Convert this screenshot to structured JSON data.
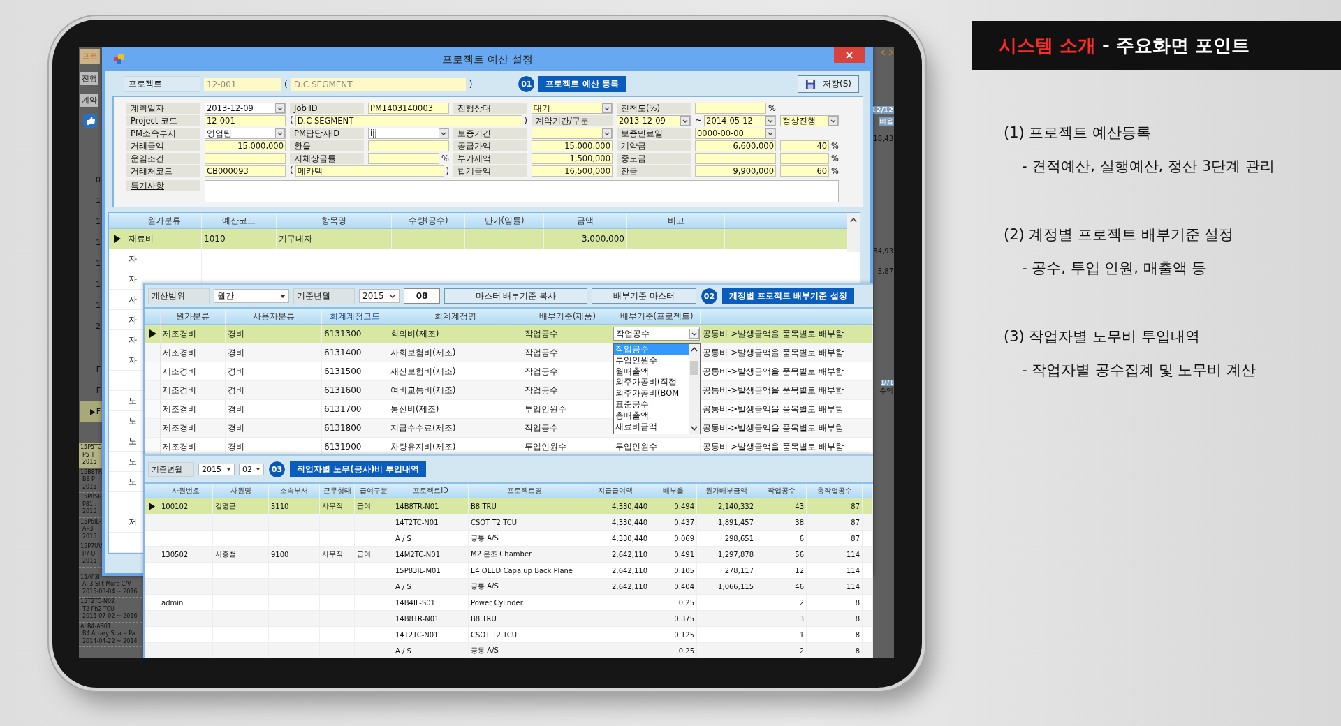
{
  "slide": {
    "title_highlight": "시스템 소개",
    "title_rest": " - 주요화면 포인트",
    "points": [
      {
        "heading": "(1) 프로젝트 예산등록",
        "detail": "- 견적예산, 실행예산, 정산 3단계 관리"
      },
      {
        "heading": "(2) 계정별 프로젝트 배부기준 설정",
        "detail": "- 공수, 투입 인원, 매출액 등"
      },
      {
        "heading": "(3) 작업자별 노무비 투입내역",
        "detail": "- 작업자별 공수집계 및 노무비 계산"
      }
    ]
  },
  "background_app": {
    "tab": "프로",
    "labels": [
      "진행",
      "계약"
    ],
    "row_marks": [
      {
        "text": "0",
        "selected": false
      },
      {
        "text": "1",
        "selected": false
      },
      {
        "text": "1",
        "selected": false
      },
      {
        "text": "1",
        "selected": false
      },
      {
        "text": "1",
        "selected": false
      },
      {
        "text": "1",
        "selected": false
      },
      {
        "text": "1",
        "selected": false
      },
      {
        "text": "2",
        "selected": false
      },
      {
        "text": "F",
        "selected": false
      },
      {
        "text": "F",
        "selected": false
      },
      {
        "text": "F",
        "selected": true
      }
    ],
    "projects": [
      {
        "code": "15P5TC",
        "name": "P5 T",
        "period": "2015",
        "selected": true
      },
      {
        "code": "15B8TR",
        "name": "B8 P",
        "period": "2015",
        "selected": false
      },
      {
        "code": "15P8SI-",
        "name": "P81 :",
        "period": "2015",
        "selected": false
      },
      {
        "code": "15P6IL-",
        "name": "AP3",
        "period": "2015",
        "selected": false
      },
      {
        "code": "15P7UV",
        "name": "P7 U",
        "period": "2015",
        "selected": false
      },
      {
        "code": "15AP3I",
        "name": "AP3 Slit Mura C/V",
        "period": "2015-08-04 ~ 2016",
        "selected": false
      },
      {
        "code": "15T2TC-N02",
        "name": "T2 Ph2 TCU",
        "period": "2015-07-02 ~ 2016",
        "selected": false
      },
      {
        "code": "ALB4-AS01",
        "name": "B4 Arrary Spare Pa",
        "period": "2014-04-22 ~ 2014",
        "selected": false
      }
    ],
    "right_values": [
      "12/12",
      "비율",
      "18,43",
      "34,93",
      "5,87",
      "1/71",
      "수익"
    ]
  },
  "dialog": {
    "title": "프로젝트 예산 설정",
    "project": {
      "label": "프로젝트",
      "code": "12-001",
      "open": "(",
      "name": "D.C SEGMENT",
      "close": ")"
    },
    "step": {
      "number": "01",
      "title": "프로젝트 예산 등록"
    },
    "save_button": "저장(S)",
    "form": {
      "lines": [
        {
          "items": [
            {
              "kind": "label",
              "text": "계획일자"
            },
            {
              "kind": "picker",
              "value": "2013-12-09"
            },
            {
              "kind": "label",
              "text": "Job ID"
            },
            {
              "kind": "input",
              "value": "PM1403140003"
            },
            {
              "kind": "label",
              "text": "진행상태"
            },
            {
              "kind": "combo",
              "value": "대기"
            },
            {
              "kind": "label",
              "text": "진척도(%)"
            },
            {
              "kind": "input",
              "suffix": "%"
            }
          ]
        },
        {
          "items": [
            {
              "kind": "label",
              "text": "Project 코드"
            },
            {
              "kind": "input",
              "value": "12-001"
            },
            {
              "kind": "input",
              "value": "D.C SEGMENT",
              "prefix": "(",
              "suffix": ")"
            },
            {
              "kind": "label",
              "text": "계약기간/구분"
            },
            {
              "kind": "combo",
              "value": "2013-12-09"
            },
            {
              "kind": "combo",
              "value": "2014-05-12",
              "prefix": "~"
            },
            {
              "kind": "combo",
              "value": "정상진행"
            }
          ]
        },
        {
          "items": [
            {
              "kind": "label",
              "text": "PM소속부서"
            },
            {
              "kind": "picker",
              "value": "영업팀"
            },
            {
              "kind": "label",
              "text": "PM담당자ID"
            },
            {
              "kind": "picker",
              "value": "ijj"
            },
            {
              "kind": "label",
              "text": "보증기간"
            },
            {
              "kind": "combo"
            },
            {
              "kind": "label",
              "text": "보증만료일"
            },
            {
              "kind": "combo",
              "value": "0000-00-00"
            }
          ]
        },
        {
          "items": [
            {
              "kind": "label",
              "text": "거래금액"
            },
            {
              "kind": "input",
              "value": "15,000,000",
              "numeric": true
            },
            {
              "kind": "label",
              "text": "환율"
            },
            {
              "kind": "input"
            },
            {
              "kind": "label",
              "text": "공급가액"
            },
            {
              "kind": "input",
              "value": "15,000,000",
              "numeric": true
            },
            {
              "kind": "label",
              "text": "계약금"
            },
            {
              "kind": "input",
              "value": "6,600,000",
              "numeric": true
            },
            {
              "kind": "input",
              "value": "40",
              "numeric": true,
              "suffix": "%"
            }
          ]
        },
        {
          "items": [
            {
              "kind": "label",
              "text": "운임조건"
            },
            {
              "kind": "input"
            },
            {
              "kind": "label",
              "text": "지체상금률"
            },
            {
              "kind": "input",
              "suffix": "%"
            },
            {
              "kind": "label",
              "text": "부가세액"
            },
            {
              "kind": "input",
              "value": "1,500,000",
              "numeric": true
            },
            {
              "kind": "label",
              "text": "중도금"
            },
            {
              "kind": "input"
            },
            {
              "kind": "input",
              "suffix": "%"
            }
          ]
        },
        {
          "items": [
            {
              "kind": "label",
              "text": "거래처코드"
            },
            {
              "kind": "input",
              "value": "CB000093"
            },
            {
              "kind": "input",
              "value": "메카텍",
              "prefix": "(",
              "suffix": ")"
            },
            {
              "kind": "label",
              "text": "합계금액"
            },
            {
              "kind": "input",
              "value": "16,500,000",
              "numeric": true
            },
            {
              "kind": "label",
              "text": "잔금"
            },
            {
              "kind": "input",
              "value": "9,900,000",
              "numeric": true
            },
            {
              "kind": "input",
              "value": "60",
              "numeric": true,
              "suffix": "%"
            }
          ]
        },
        {
          "items": [
            {
              "kind": "link",
              "text": "특기사항"
            },
            {
              "kind": "memo"
            }
          ]
        }
      ]
    },
    "budget_grid": {
      "columns": [
        "원가분류",
        "예산코드",
        "항목명",
        "수량(공수)",
        "단가(임률)",
        "금액",
        "비고"
      ],
      "rows": [
        {
          "cost_type": "재료비",
          "budget_code": "1010",
          "item_name": "기구내자",
          "amount": "3,000,000",
          "selected": true
        }
      ],
      "covered_row_groups": [
        [
          "자",
          "자",
          "자",
          "자",
          "자",
          "자"
        ],
        [
          "노",
          "노",
          "노",
          "노",
          "노"
        ],
        [
          "저"
        ]
      ]
    }
  },
  "allocation_panel": {
    "range_label": "계산범위",
    "range_value": "월간",
    "month_label": "기준년월",
    "year": "2015",
    "month": "08",
    "copy_button": "마스터 배부기준 복사",
    "master_button": "배부기준 마스터",
    "step": {
      "number": "02",
      "title": "계정별 프로젝트 배부기준 설정"
    },
    "columns": [
      {
        "title": "원가분류",
        "linked": false
      },
      {
        "title": "사용자분류",
        "linked": false
      },
      {
        "title": "회계계정코드",
        "linked": true
      },
      {
        "title": "회계계정명",
        "linked": false
      },
      {
        "title": "배부기준(제품)",
        "linked": false
      },
      {
        "title": "배부기준(프로젝트)",
        "linked": false
      }
    ],
    "rows": [
      {
        "cost_type": "제조경비",
        "user_class": "경비",
        "account_code": "6131300",
        "account_name": "회의비(제조)",
        "basis_product": "작업공수",
        "editor": {
          "value": "작업공수",
          "options": [
            {
              "text": "작업공수",
              "selected": true
            },
            {
              "text": "투입인원수",
              "selected": false
            },
            {
              "text": "월매출액",
              "selected": false
            },
            {
              "text": "외주가공비(직접",
              "selected": false
            },
            {
              "text": "외주가공비(BOM",
              "selected": false
            },
            {
              "text": "표준공수",
              "selected": false
            },
            {
              "text": "총매출액",
              "selected": false
            },
            {
              "text": "재료비금액",
              "selected": false
            }
          ]
        },
        "description": "공통비->발생금액을 품목별로 배부함",
        "selected": true
      },
      {
        "cost_type": "제조경비",
        "user_class": "경비",
        "account_code": "6131400",
        "account_name": "사회보험비(제조)",
        "basis_product": "작업공수",
        "description": "공통비->발생금액을 품목별로 배부함",
        "selected": false
      },
      {
        "cost_type": "제조경비",
        "user_class": "경비",
        "account_code": "6131500",
        "account_name": "재산보험비(제조)",
        "basis_product": "작업공수",
        "description": "공통비->발생금액을 품목별로 배부함",
        "selected": false
      },
      {
        "cost_type": "제조경비",
        "user_class": "경비",
        "account_code": "6131600",
        "account_name": "여비교통비(제조)",
        "basis_product": "작업공수",
        "description": "공통비->발생금액을 품목별로 배부함",
        "selected": false
      },
      {
        "cost_type": "제조경비",
        "user_class": "경비",
        "account_code": "6131700",
        "account_name": "통신비(제조)",
        "basis_product": "투입인원수",
        "description": "공통비->발생금액을 품목별로 배부함",
        "selected": false
      },
      {
        "cost_type": "제조경비",
        "user_class": "경비",
        "account_code": "6131800",
        "account_name": "지급수수료(제조)",
        "basis_product": "작업공수",
        "description": "공통비->발생금액을 품목별로 배부함",
        "selected": false
      },
      {
        "cost_type": "제조경비",
        "user_class": "경비",
        "account_code": "6131900",
        "account_name": "차량유지비(제조)",
        "basis_product": "투입인원수",
        "basis_project": "투입인원수",
        "description": "공통비->발생금액을 품목별로 배부함",
        "selected": false
      }
    ]
  },
  "labor_panel": {
    "month_label": "기준년월",
    "year": "2015",
    "month": "02",
    "step": {
      "number": "03",
      "title": "작업자별 노무(공사)비 투입내역"
    },
    "columns": [
      "사원번호",
      "사원명",
      "소속부서",
      "근무형태",
      "급여구분",
      "프로젝트ID",
      "프로젝트명",
      "지급급여액",
      "배부율",
      "원가배부금액",
      "작업공수",
      "총작업공수"
    ],
    "rows": [
      {
        "emp_no": "100102",
        "emp_name": "김영근",
        "dept": "5110",
        "work_type": "사무직",
        "pay_type": "급여",
        "project_id": "14B8TR-N01",
        "project_name": "B8 TRU",
        "pay_amount": "4,330,440",
        "ratio": "0.494",
        "cost_amount": "2,140,332",
        "work_hours": "43",
        "total_hours": "87",
        "selected": true
      },
      {
        "project_id": "14T2TC-N01",
        "project_name": "CSOT T2 TCU",
        "pay_amount": "4,330,440",
        "ratio": "0.437",
        "cost_amount": "1,891,457",
        "work_hours": "38",
        "total_hours": "87",
        "selected": false
      },
      {
        "project_id": "A / S",
        "project_name": "공통 A/S",
        "pay_amount": "4,330,440",
        "ratio": "0.069",
        "cost_amount": "298,651",
        "work_hours": "6",
        "total_hours": "87",
        "selected": false
      },
      {
        "emp_no": "130502",
        "emp_name": "서종철",
        "dept": "9100",
        "work_type": "사무직",
        "pay_type": "급여",
        "project_id": "14M2TC-N01",
        "project_name": "M2 온조 Chamber",
        "pay_amount": "2,642,110",
        "ratio": "0.491",
        "cost_amount": "1,297,878",
        "work_hours": "56",
        "total_hours": "114",
        "selected": false
      },
      {
        "project_id": "15P83IL-M01",
        "project_name": "E4 OLED Capa up Back Plane",
        "pay_amount": "2,642,110",
        "ratio": "0.105",
        "cost_amount": "278,117",
        "work_hours": "12",
        "total_hours": "114",
        "selected": false
      },
      {
        "project_id": "A / S",
        "project_name": "공통 A/S",
        "pay_amount": "2,642,110",
        "ratio": "0.404",
        "cost_amount": "1,066,115",
        "work_hours": "46",
        "total_hours": "114",
        "selected": false
      },
      {
        "emp_no": "admin",
        "project_id": "14B4IL-S01",
        "project_name": "Power Cylinder",
        "ratio": "0.25",
        "work_hours": "2",
        "total_hours": "8",
        "selected": false
      },
      {
        "project_id": "14B8TR-N01",
        "project_name": "B8 TRU",
        "ratio": "0.375",
        "work_hours": "3",
        "total_hours": "8",
        "selected": false
      },
      {
        "project_id": "14T2TC-N01",
        "project_name": "CSOT T2 TCU",
        "ratio": "0.125",
        "work_hours": "1",
        "total_hours": "8",
        "selected": false
      },
      {
        "project_id": "A / S",
        "project_name": "공통 A/S",
        "ratio": "0.25",
        "work_hours": "2",
        "total_hours": "8",
        "selected": false
      }
    ]
  }
}
